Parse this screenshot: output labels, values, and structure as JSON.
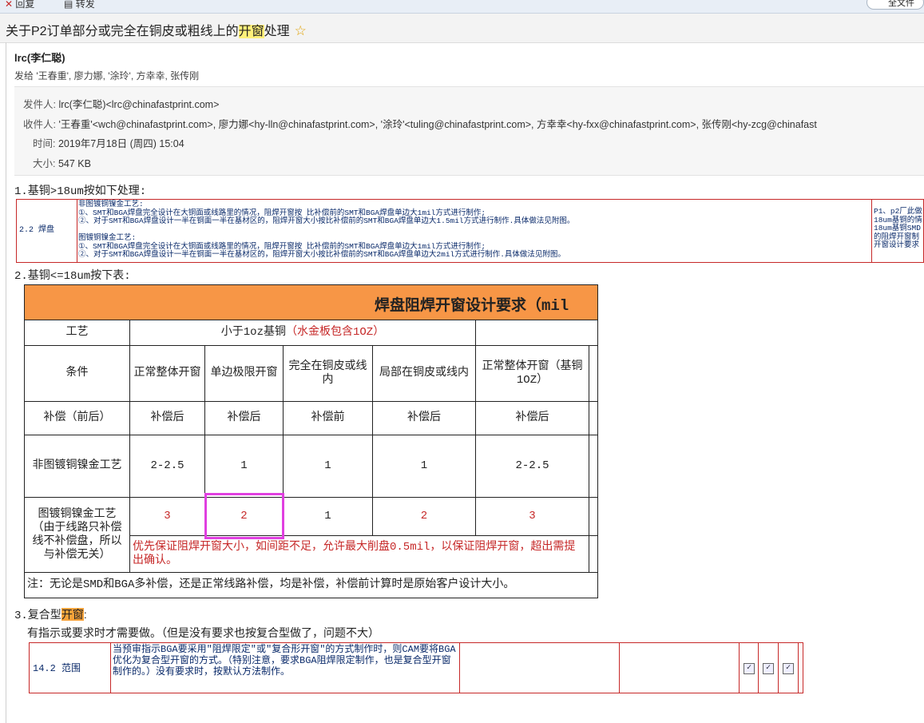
{
  "toolbar": {
    "item1": "回复",
    "item2": "转发",
    "search": "全文件"
  },
  "subject": {
    "prefix": "关于P2订单部分或完全在铜皮或粗线上的",
    "highlight": "开窗",
    "suffix": "处理",
    "star": "☆"
  },
  "sender": "lrc(李仁聪)",
  "recipients": "发给 '王春重', 廖力娜, '涂玲', 方幸幸, 张传刚",
  "header": {
    "from_label": "发件人:",
    "from": "lrc(李仁聪)<lrc@chinafastprint.com>",
    "to_label": "收件人:",
    "to": "'王春重'<wch@chinafastprint.com>,  廖力娜<hy-lln@chinafastprint.com>,  '涂玲'<tuling@chinafastprint.com>,  方幸幸<hy-fxx@chinafastprint.com>,  张传刚<hy-zcg@chinafast",
    "time_label": "时间:",
    "time": "2019年7月18日 (周四) 15:04",
    "size_label": "大小:",
    "size": "547 KB"
  },
  "section1": {
    "heading": "1.基铜>18um按如下处理:",
    "col1": "2.2 焊盘",
    "lines": [
      "非图镀铜镍金工艺:",
      "①、SMT和BGA焊盘完全设计在大铜面或线路里的情况，阻焊开窗按 比补偿前的SMT和BGA焊盘单边大1mil方式进行制作;",
      "②、对于SMT和BGA焊盘设计一半在铜面一半在基材区的，阻焊开窗大小按比补偿前的SMT和BGA焊盘单边大1.5mil方式进行制作.具体做法见附图。",
      "",
      "图镀铜镍金工艺:",
      "①、SMT和BGA焊盘完全设计在大铜面或线路里的情况，阻焊开窗按 比补偿前的SMT和BGA焊盘单边大1mil方式进行制作;",
      "②、对于SMT和BGA焊盘设计一半在铜面一半在基材区的，阻焊开窗大小按比补偿前的SMT和BGA焊盘单边大2mil方式进行制作.具体做法见附图。"
    ],
    "col3": [
      "P1、p2厂此做",
      "18um基铜的情",
      "18um基铜SMD",
      "的阻焊开窗制",
      "开窗设计要求"
    ]
  },
  "section2": {
    "heading": "2.基铜<=18um按下表:",
    "title": "焊盘阻焊开窗设计要求（mil",
    "process_label": "工艺",
    "process_value_a": "小于1oz基铜",
    "process_value_b": "（水金板包含1OZ）",
    "cond_label": "条件",
    "conds": [
      "正常整体开窗",
      "单边极限开窗",
      "完全在铜皮或线内",
      "局部在铜皮或线内",
      "正常整体开窗（基铜1OZ）"
    ],
    "comp_label": "补偿（前后）",
    "comps": [
      "补偿后",
      "补偿后",
      "补偿前",
      "补偿后",
      "补偿后"
    ],
    "row1_label": "非图镀铜镍金工艺",
    "row1": [
      "2-2.5",
      "1",
      "1",
      "1",
      "2-2.5"
    ],
    "row2_label": "图镀铜镍金工艺（由于线路只补偿线不补偿盘，所以与补偿无关）",
    "row2": [
      "3",
      "2",
      "1",
      "2",
      "3"
    ],
    "row2_note": "优先保证阻焊开窗大小，如间距不足，允许最大削盘0.5mil，以保证阻焊开窗，超出需提出确认。",
    "footnote": "注：无论是SMD和BGA多补偿，还是正常线路补偿，均是补偿，补偿前计算时是原始客户设计大小。"
  },
  "section3": {
    "heading_prefix": "3.复合型",
    "heading_hl": "开窗",
    "heading_suffix": ":",
    "sub": "有指示或要求时才需要做。（但是没有要求也按复合型做了，问题不大）",
    "col1": "14.2 范围",
    "text": "当预审指示BGA要采用\"阻焊限定\"或\"复合形开窗\"的方式制作时，则CAM要将BGA优化为复合型开窗的方式。（特别注意，要求BGA阻焊限定制作，也是复合型开窗制作的。）没有要求时，按默认方法制作。",
    "check": "✓"
  }
}
